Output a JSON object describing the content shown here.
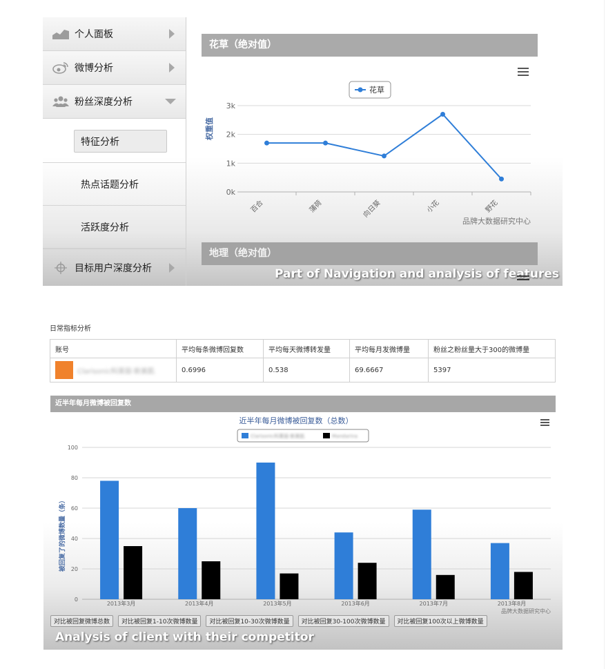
{
  "sidebar": {
    "items": [
      {
        "label": "个人面板",
        "icon": "area-chart-icon"
      },
      {
        "label": "微博分析",
        "icon": "weibo-icon"
      },
      {
        "label": "粉丝深度分析",
        "icon": "users-icon"
      },
      {
        "label": "特征分析"
      },
      {
        "label": "热点话题分析"
      },
      {
        "label": "活跃度分析"
      },
      {
        "label": "目标用户深度分析",
        "icon": "crosshair-icon"
      }
    ]
  },
  "top_chart": {
    "header": "花草（绝对值）",
    "legend": "花草",
    "ylabel": "权重值",
    "credit": "品牌大数据研究中心",
    "next_header": "地理（绝对值）",
    "caption": "Part of Navigation and analysis of features"
  },
  "daily": {
    "title": "日常指标分析",
    "columns": [
      "账号",
      "平均每条微博回复数",
      "平均每天微博转发量",
      "平均每月发微博量",
      "粉丝之粉丝量大于300的微博量"
    ],
    "row": {
      "account": "Clarisonic科莱丽·新美肌",
      "v1": "0.6996",
      "v2": "0.538",
      "v3": "69.6667",
      "v4": "5397"
    }
  },
  "bottom": {
    "header": "近半年每月微博被回复数",
    "caption": "Analysis of client with their competitor",
    "buttons": [
      "对比被回复微博总数",
      "对比被回复1-10次微博数量",
      "对比被回复10-30次微博数量",
      "对比被回复30-100次微博数量",
      "对比被回复100次以上微博数量"
    ]
  },
  "chart_data": [
    {
      "type": "line",
      "title": "",
      "ylabel": "权重值",
      "categories": [
        "百合",
        "蒲荷",
        "向日葵",
        "小花",
        "野花"
      ],
      "series": [
        {
          "name": "花草",
          "values": [
            1700,
            1700,
            1250,
            2700,
            450
          ],
          "color": "#2f7ed8"
        }
      ],
      "yticks": [
        "0k",
        "1k",
        "2k",
        "3k"
      ],
      "ylim": [
        0,
        3000
      ],
      "legend": "top-center",
      "grid": true,
      "credit": "品牌大数据研究中心"
    },
    {
      "type": "bar",
      "title": "近半年每月微博被回复数（总数）",
      "ylabel": "被回复了的微博数量（条）",
      "categories": [
        "2013年3月",
        "2013年4月",
        "2013年5月",
        "2013年6月",
        "2013年7月",
        "2013年8月"
      ],
      "series": [
        {
          "name": "Clarisonic科莱丽·新美肌",
          "values": [
            78,
            60,
            90,
            44,
            59,
            37
          ],
          "color": "#2f7ed8"
        },
        {
          "name": "Mandarina",
          "values": [
            35,
            25,
            17,
            24,
            16,
            18
          ],
          "color": "#000000"
        }
      ],
      "yticks": [
        "0",
        "20",
        "40",
        "60",
        "80",
        "100"
      ],
      "ylim": [
        0,
        100
      ],
      "legend": "top-center",
      "grid": true,
      "credit": "品牌大数据研究中心"
    }
  ]
}
